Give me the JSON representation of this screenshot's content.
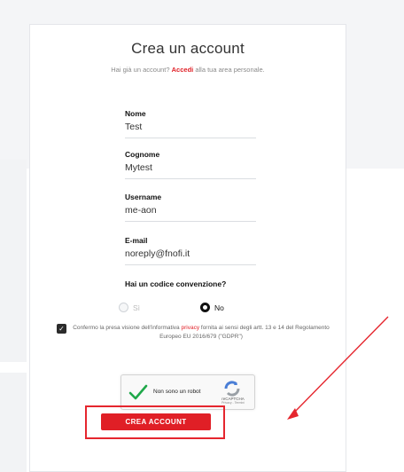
{
  "colors": {
    "accent": "#e01f26",
    "annotation": "#e5262e"
  },
  "title": "Crea un account",
  "subtitle": {
    "prefix": "Hai già un account?",
    "link": "Accedi",
    "suffix": "alla tua area personale."
  },
  "fields": [
    {
      "label": "Nome",
      "value": "Test"
    },
    {
      "label": "Cognome",
      "value": "Mytest"
    },
    {
      "label": "Username",
      "value": "me-aon"
    },
    {
      "label": "E-mail",
      "value": "noreply@fnofi.it"
    }
  ],
  "convention": {
    "question": "Hai un codice convenzione?",
    "options": [
      "Sì",
      "No"
    ],
    "selected": "No"
  },
  "consent": {
    "checked": true,
    "text_before": "Confermo la presa visione dell'informativa",
    "link": "privacy",
    "text_after": "fornita ai sensi degli artt. 13 e 14 del Regolamento Europeo EU 2016/679 (\"GDPR\")"
  },
  "recaptcha": {
    "label": "Non sono un robot",
    "brand": "reCAPTCHA",
    "links": "Privacy - Termini",
    "checked": true,
    "icon": "recaptcha-logo-icon"
  },
  "submit_label": "CREA ACCOUNT"
}
